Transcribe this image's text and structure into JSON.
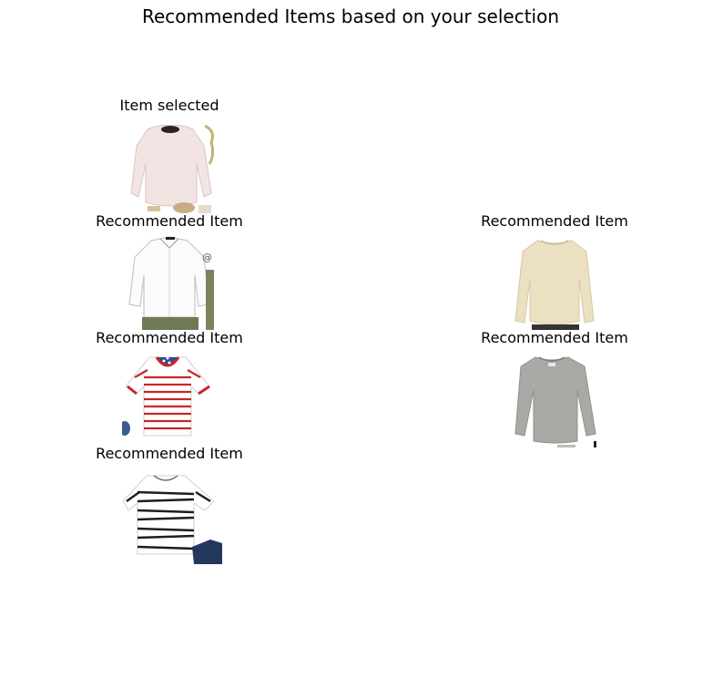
{
  "page": {
    "title": "Recommended Items based on your selection"
  },
  "selected": {
    "label": "Item selected",
    "icon": "pink-knit-sweater-image"
  },
  "recommendations": [
    {
      "label": "Recommended Item",
      "icon": "white-button-shirt-image"
    },
    {
      "label": "Recommended Item",
      "icon": "beige-long-sleeve-top-image"
    },
    {
      "label": "Recommended Item",
      "icon": "red-striped-tee-image"
    },
    {
      "label": "Recommended Item",
      "icon": "grey-long-sleeve-top-image"
    },
    {
      "label": "Recommended Item",
      "icon": "black-striped-tee-image"
    }
  ],
  "colors": {
    "background": "#ffffff",
    "text": "#000000"
  }
}
